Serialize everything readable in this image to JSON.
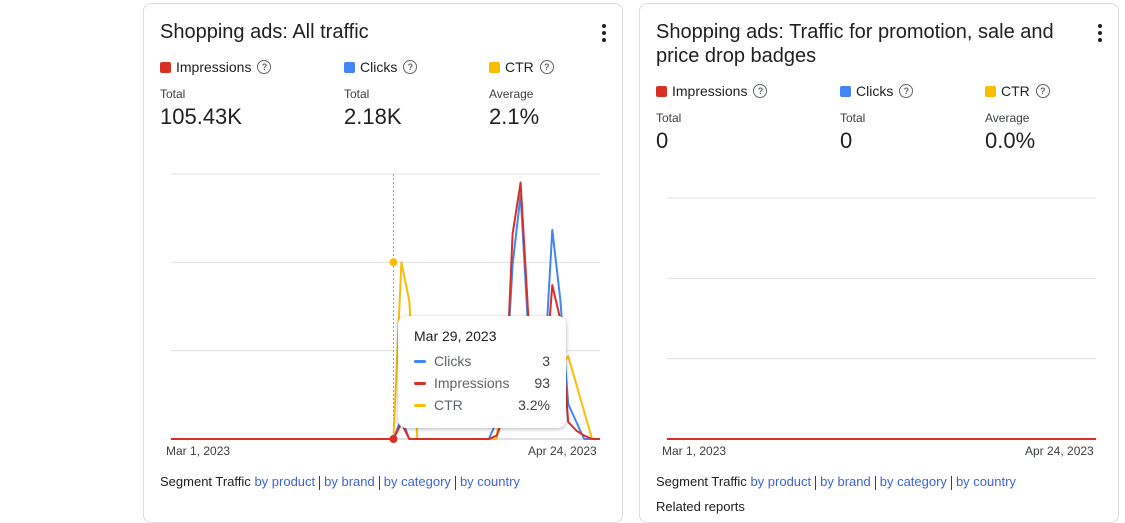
{
  "colors": {
    "impressions": "#d93025",
    "clicks": "#4285f4",
    "ctr": "#fbbc04",
    "link": "#3c64d8"
  },
  "card1": {
    "title": "Shopping ads: All traffic",
    "metrics": [
      {
        "name": "Impressions",
        "label": "Total",
        "value": "105.43K"
      },
      {
        "name": "Clicks",
        "label": "Total",
        "value": "2.18K"
      },
      {
        "name": "CTR",
        "label": "Average",
        "value": "2.1%"
      }
    ],
    "x_start": "Mar 1, 2023",
    "x_end": "Apr 24, 2023",
    "tooltip": {
      "date": "Mar 29, 2023",
      "rows": [
        {
          "name": "Clicks",
          "value": "3"
        },
        {
          "name": "Impressions",
          "value": "93"
        },
        {
          "name": "CTR",
          "value": "3.2%"
        }
      ]
    },
    "segment": {
      "label": "Segment Traffic",
      "links": [
        "by product",
        "by brand",
        "by category",
        "by country"
      ]
    }
  },
  "card2": {
    "title": "Shopping ads: Traffic for promotion, sale and price drop badges",
    "metrics": [
      {
        "name": "Impressions",
        "label": "Total",
        "value": "0"
      },
      {
        "name": "Clicks",
        "label": "Total",
        "value": "0"
      },
      {
        "name": "CTR",
        "label": "Average",
        "value": "0.0%"
      }
    ],
    "x_start": "Mar 1, 2023",
    "x_end": "Apr 24, 2023",
    "segment": {
      "label": "Segment Traffic",
      "links": [
        "by product",
        "by brand",
        "by category",
        "by country"
      ]
    },
    "related": "Related reports"
  },
  "chart_data": [
    {
      "type": "line",
      "x_range": [
        "Mar 1, 2023",
        "Apr 24, 2023"
      ],
      "hover_date": "Mar 29, 2023",
      "series": [
        {
          "name": "Impressions",
          "points": [
            [
              0,
              0
            ],
            [
              28,
              0
            ],
            [
              29,
              93
            ],
            [
              30,
              0
            ],
            [
              32,
              0
            ],
            [
              40,
              0
            ],
            [
              41,
              20
            ],
            [
              42,
              140
            ],
            [
              43,
              1200
            ],
            [
              44,
              1500
            ],
            [
              45,
              700
            ],
            [
              46,
              200
            ],
            [
              47,
              300
            ],
            [
              48,
              900
            ],
            [
              49,
              700
            ],
            [
              50,
              100
            ],
            [
              51,
              50
            ],
            [
              52,
              20
            ],
            [
              53,
              0
            ],
            [
              54,
              0
            ]
          ]
        },
        {
          "name": "Clicks",
          "points": [
            [
              0,
              0
            ],
            [
              28,
              0
            ],
            [
              29,
              3
            ],
            [
              30,
              0
            ],
            [
              32,
              0
            ],
            [
              40,
              0
            ],
            [
              42,
              5
            ],
            [
              43,
              25
            ],
            [
              44,
              35
            ],
            [
              45,
              15
            ],
            [
              46,
              5
            ],
            [
              47,
              10
            ],
            [
              48,
              30
            ],
            [
              49,
              20
            ],
            [
              50,
              5
            ],
            [
              52,
              0
            ],
            [
              54,
              0
            ]
          ]
        },
        {
          "name": "CTR",
          "points": [
            [
              0,
              0
            ],
            [
              28,
              0
            ],
            [
              29,
              3.2
            ],
            [
              30,
              2.5
            ],
            [
              31,
              0
            ],
            [
              41,
              0
            ],
            [
              42,
              1.5
            ],
            [
              43,
              0.8
            ],
            [
              44,
              1.0
            ],
            [
              45,
              1.2
            ],
            [
              46,
              1.3
            ],
            [
              47,
              1.5
            ],
            [
              48,
              1.5
            ],
            [
              49,
              1.3
            ],
            [
              50,
              1.5
            ],
            [
              51,
              1.0
            ],
            [
              52,
              0.5
            ],
            [
              53,
              0
            ],
            [
              54,
              0
            ]
          ]
        }
      ],
      "grid": true
    },
    {
      "type": "line",
      "x_range": [
        "Mar 1, 2023",
        "Apr 24, 2023"
      ],
      "series": [
        {
          "name": "Impressions",
          "points": [
            [
              0,
              0
            ],
            [
              54,
              0
            ]
          ]
        },
        {
          "name": "Clicks",
          "points": [
            [
              0,
              0
            ],
            [
              54,
              0
            ]
          ]
        },
        {
          "name": "CTR",
          "points": [
            [
              0,
              0
            ],
            [
              54,
              0
            ]
          ]
        }
      ],
      "grid": true
    }
  ]
}
